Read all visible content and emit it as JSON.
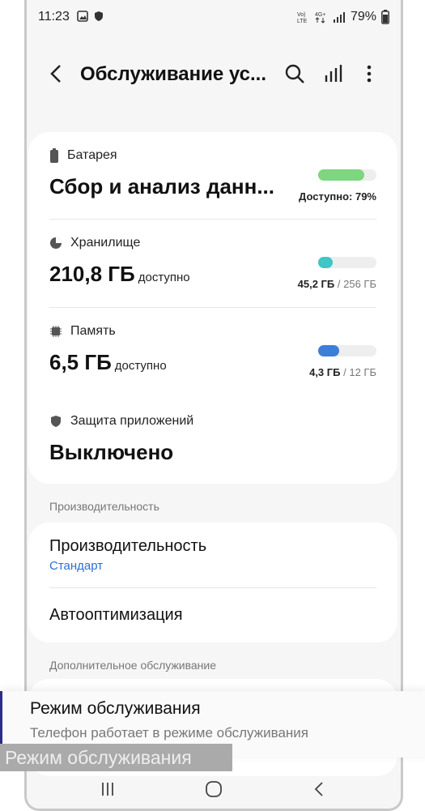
{
  "status": {
    "time": "11:23",
    "battery": "79%"
  },
  "header": {
    "title": "Обслуживание ус..."
  },
  "cards": {
    "battery": {
      "label": "Батарея",
      "value": "Сбор и анализ данн...",
      "meta": "Доступно: 79%",
      "level": 0.79,
      "color": "#7ed67e"
    },
    "storage": {
      "label": "Хранилище",
      "value": "210,8 ГБ",
      "unit": "доступно",
      "used": "45,2 ГБ",
      "total": "/ 256 ГБ",
      "level": 0.18,
      "color": "#3fc6c6"
    },
    "memory": {
      "label": "Память",
      "value": "6,5 ГБ",
      "unit": "доступно",
      "used": "4,3 ГБ",
      "total": "/ 12 ГБ",
      "level": 0.36,
      "color": "#3b7fd9"
    },
    "protection": {
      "label": "Защита приложений",
      "value": "Выключено"
    }
  },
  "performance": {
    "section": "Производительность",
    "item_title": "Производительность",
    "item_sub": "Стандарт",
    "auto": "Автооптимизация"
  },
  "more": {
    "section": "Дополнительное обслуживание"
  },
  "toast": {
    "title": "Режим обслуживания",
    "text": "Телефон работает в режиме обслуживания",
    "overlay": "Режим обслуживания"
  }
}
